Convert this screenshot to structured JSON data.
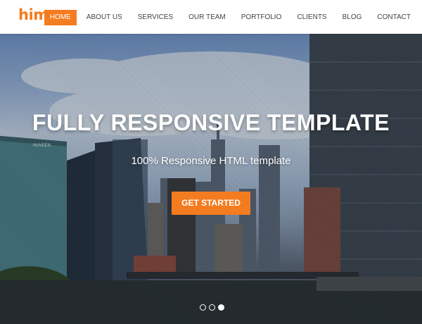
{
  "brand": {
    "name": "himu",
    "color": "#f47c20"
  },
  "nav": {
    "items": [
      {
        "label": "HOME",
        "active": true
      },
      {
        "label": "ABOUT US",
        "active": false
      },
      {
        "label": "SERVICES",
        "active": false
      },
      {
        "label": "OUR TEAM",
        "active": false
      },
      {
        "label": "PORTFOLIO",
        "active": false
      },
      {
        "label": "CLIENTS",
        "active": false
      },
      {
        "label": "BLOG",
        "active": false
      },
      {
        "label": "CONTACT",
        "active": false
      }
    ]
  },
  "hero": {
    "title": "FULLY RESPONSIVE TEMPLATE",
    "subtitle": "100% Responsive HTML template",
    "cta_label": "GET STARTED",
    "building_sign": "NUVEEN",
    "background": "city skyline photo"
  },
  "slider": {
    "count": 3,
    "active_index": 2
  }
}
